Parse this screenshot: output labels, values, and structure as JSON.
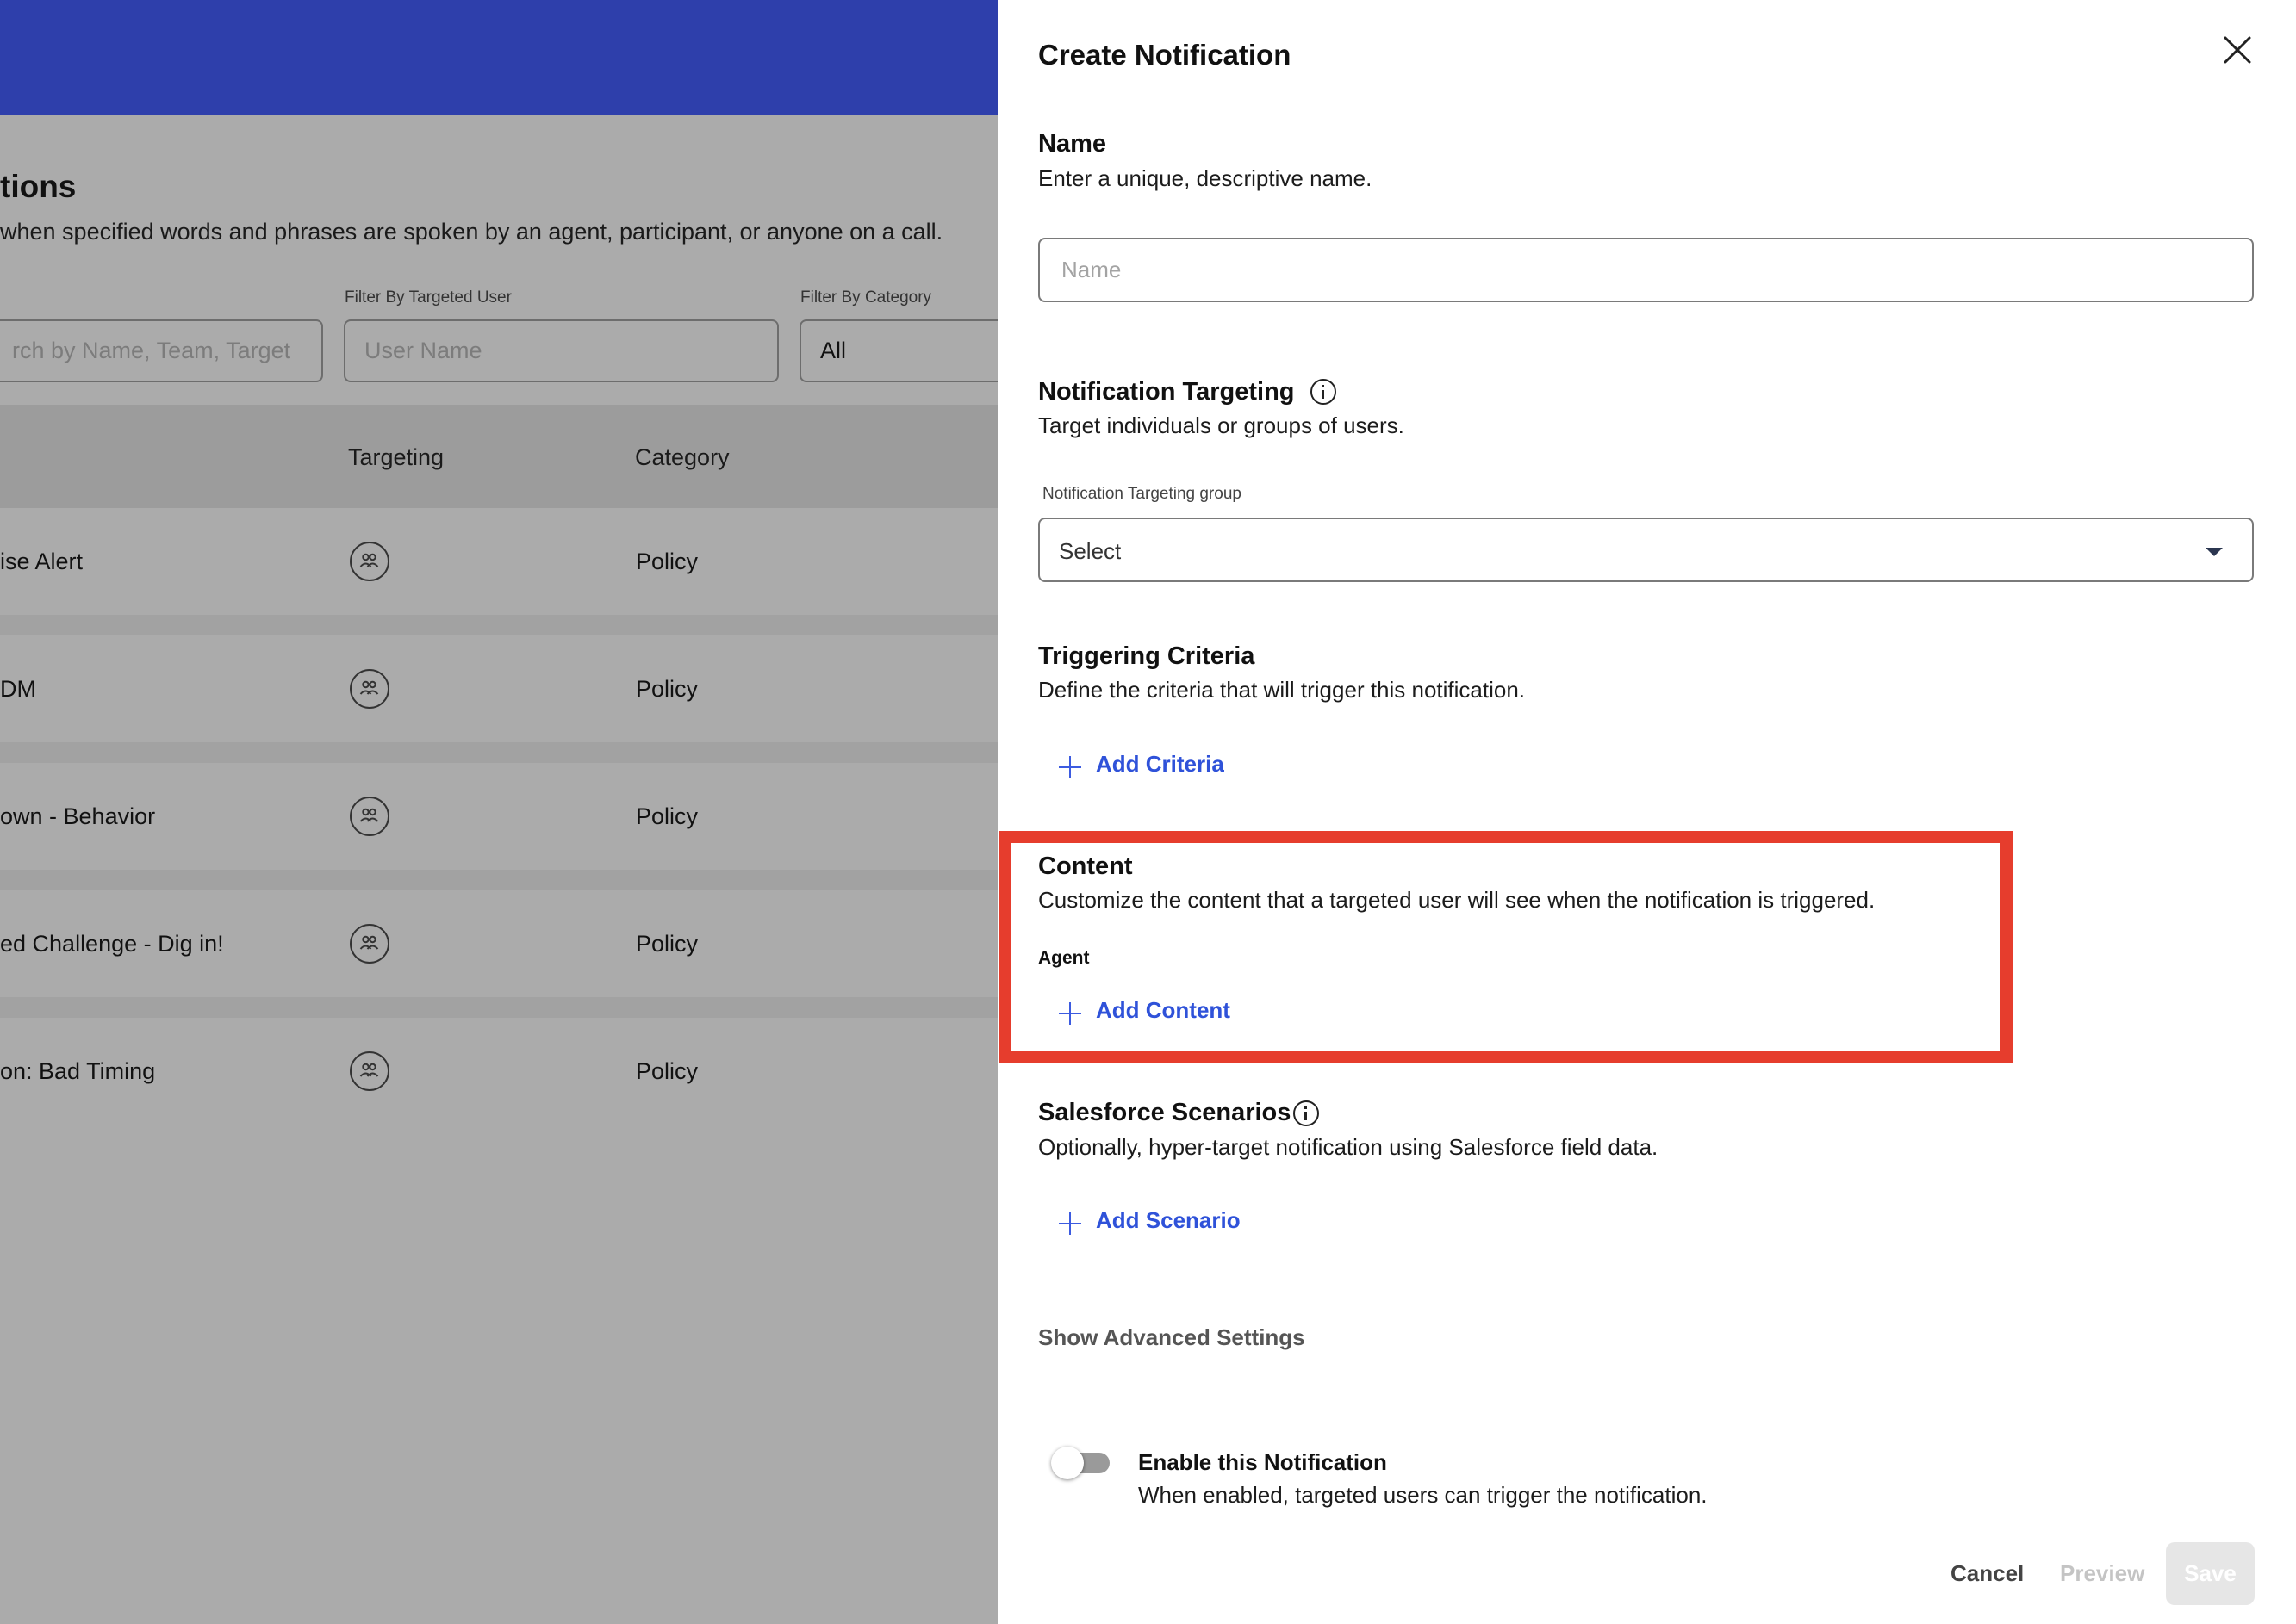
{
  "background": {
    "title": "tions",
    "description": " when specified words and phrases are spoken by an agent, participant, or anyone on a call.",
    "filters": {
      "search": {
        "placeholder": "rch by Name, Team, Target"
      },
      "user": {
        "label": "Filter By Targeted User",
        "placeholder": "User Name"
      },
      "category": {
        "label": "Filter By Category",
        "value": "All"
      }
    },
    "table": {
      "headers": {
        "targeting": "Targeting",
        "category": "Category"
      },
      "rows": [
        {
          "name": "ise Alert",
          "category": "Policy"
        },
        {
          "name": "DM",
          "category": "Policy"
        },
        {
          "name": "own - Behavior",
          "category": "Policy"
        },
        {
          "name": "ed Challenge - Dig in!",
          "category": "Policy"
        },
        {
          "name": "on: Bad Timing",
          "category": "Policy"
        }
      ]
    }
  },
  "panel": {
    "title": "Create Notification",
    "name": {
      "title": "Name",
      "description": "Enter a unique, descriptive name.",
      "placeholder": "Name",
      "value": ""
    },
    "targeting": {
      "title": "Notification Targeting",
      "description": "Target individuals or groups of users.",
      "field_label": "Notification Targeting group",
      "selected": "Select"
    },
    "triggering": {
      "title": "Triggering Criteria",
      "description": "Define the criteria that will trigger this notification.",
      "add_label": "Add Criteria"
    },
    "content": {
      "title": "Content",
      "description": "Customize the content that a targeted user will see when the notification is triggered.",
      "agent_label": "Agent",
      "add_label": "Add Content"
    },
    "salesforce": {
      "title": "Salesforce Scenarios",
      "description": "Optionally, hyper-target notification using Salesforce field data.",
      "add_label": "Add Scenario"
    },
    "advanced_label": "Show Advanced Settings",
    "enable": {
      "title": "Enable this Notification",
      "description": "When enabled, targeted users can trigger the notification.",
      "on": false
    },
    "buttons": {
      "cancel": "Cancel",
      "preview": "Preview",
      "save": "Save"
    }
  },
  "colors": {
    "header_blue": "#2e3fab",
    "link_blue": "#2f52d9",
    "highlight_red": "#e63d2d",
    "overlay_gray": "#ababab"
  },
  "icons": [
    "group-icon",
    "close-icon",
    "info-icon",
    "plus-icon",
    "chevron-down-icon"
  ]
}
